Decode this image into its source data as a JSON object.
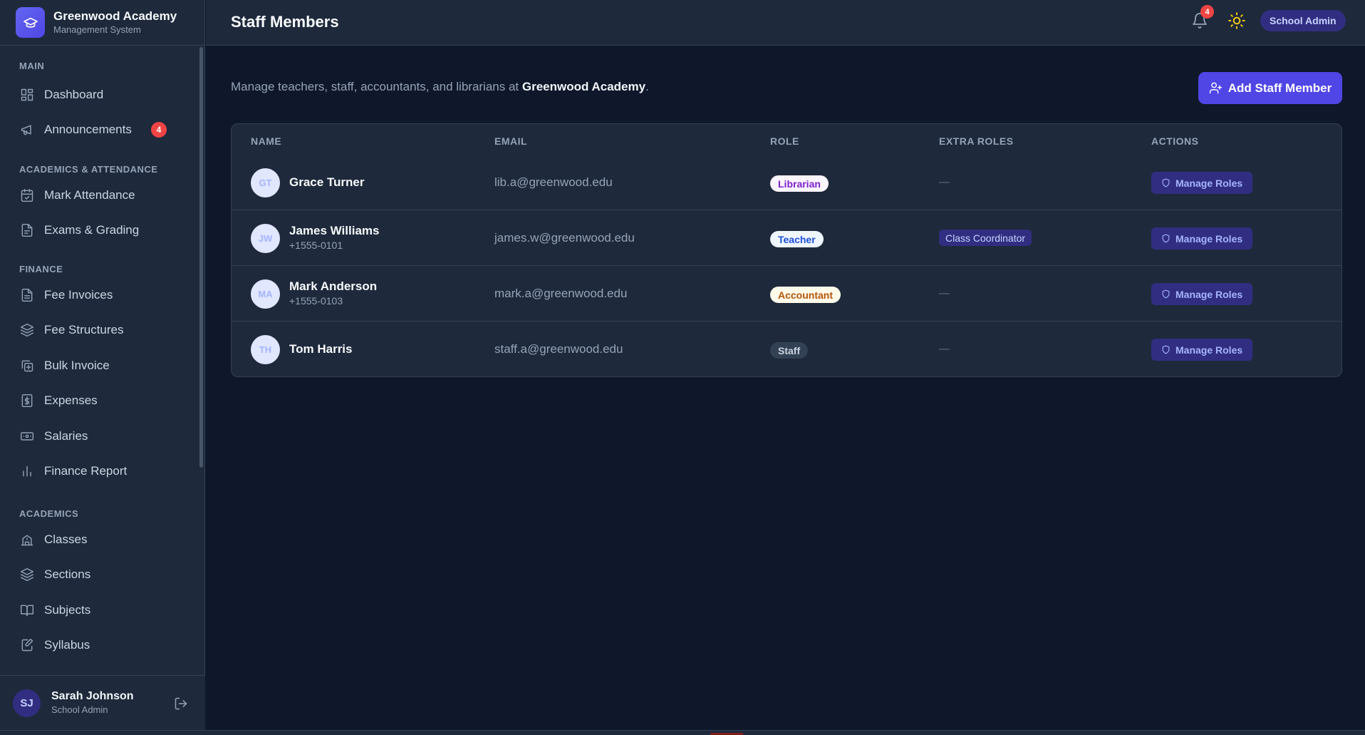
{
  "brand": {
    "title": "Greenwood Academy",
    "subtitle": "Management System"
  },
  "sidebar": {
    "sections": {
      "main": "MAIN",
      "academics_attendance": "ACADEMICS & ATTENDANCE",
      "finance": "FINANCE",
      "academics": "ACADEMICS"
    },
    "items": {
      "dashboard": "Dashboard",
      "announcements": "Announcements",
      "announcements_badge": "4",
      "mark_attendance": "Mark Attendance",
      "exams_grading": "Exams & Grading",
      "fee_invoices": "Fee Invoices",
      "fee_structures": "Fee Structures",
      "bulk_invoice": "Bulk Invoice",
      "expenses": "Expenses",
      "salaries": "Salaries",
      "finance_report": "Finance Report",
      "classes": "Classes",
      "sections": "Sections",
      "subjects": "Subjects",
      "syllabus": "Syllabus"
    },
    "user": {
      "initials": "SJ",
      "name": "Sarah Johnson",
      "role": "School Admin"
    }
  },
  "header": {
    "title": "Staff Members",
    "notification_count": "4",
    "user_role": "School Admin"
  },
  "main": {
    "intro_prefix": "Manage teachers, staff, accountants, and librarians at ",
    "intro_school": "Greenwood Academy",
    "intro_suffix": ".",
    "add_button": "Add Staff Member"
  },
  "table": {
    "headers": {
      "name": "NAME",
      "email": "EMAIL",
      "role": "ROLE",
      "extra": "EXTRA ROLES",
      "actions": "ACTIONS"
    },
    "action_label": "Manage Roles",
    "rows": [
      {
        "initials": "GT",
        "name": "Grace Turner",
        "phone": "",
        "email": "lib.a@greenwood.edu",
        "role": "Librarian",
        "extra": "—"
      },
      {
        "initials": "JW",
        "name": "James Williams",
        "phone": "+1555-0101",
        "email": "james.w@greenwood.edu",
        "role": "Teacher",
        "extra": "Class Coordinator"
      },
      {
        "initials": "MA",
        "name": "Mark Anderson",
        "phone": "+1555-0103",
        "email": "mark.a@greenwood.edu",
        "role": "Accountant",
        "extra": "—"
      },
      {
        "initials": "TH",
        "name": "Tom Harris",
        "phone": "",
        "email": "staff.a@greenwood.edu",
        "role": "Staff",
        "extra": "—"
      }
    ]
  },
  "colors": {
    "accent": "#4f46e5",
    "background": "#0f172a",
    "panel": "#1e293b",
    "badge_red": "#ef4444",
    "role_librarian": "#7e22ce",
    "role_teacher": "#1d4ed8",
    "role_accountant": "#b45309",
    "role_staff": "#cbd5e1"
  }
}
